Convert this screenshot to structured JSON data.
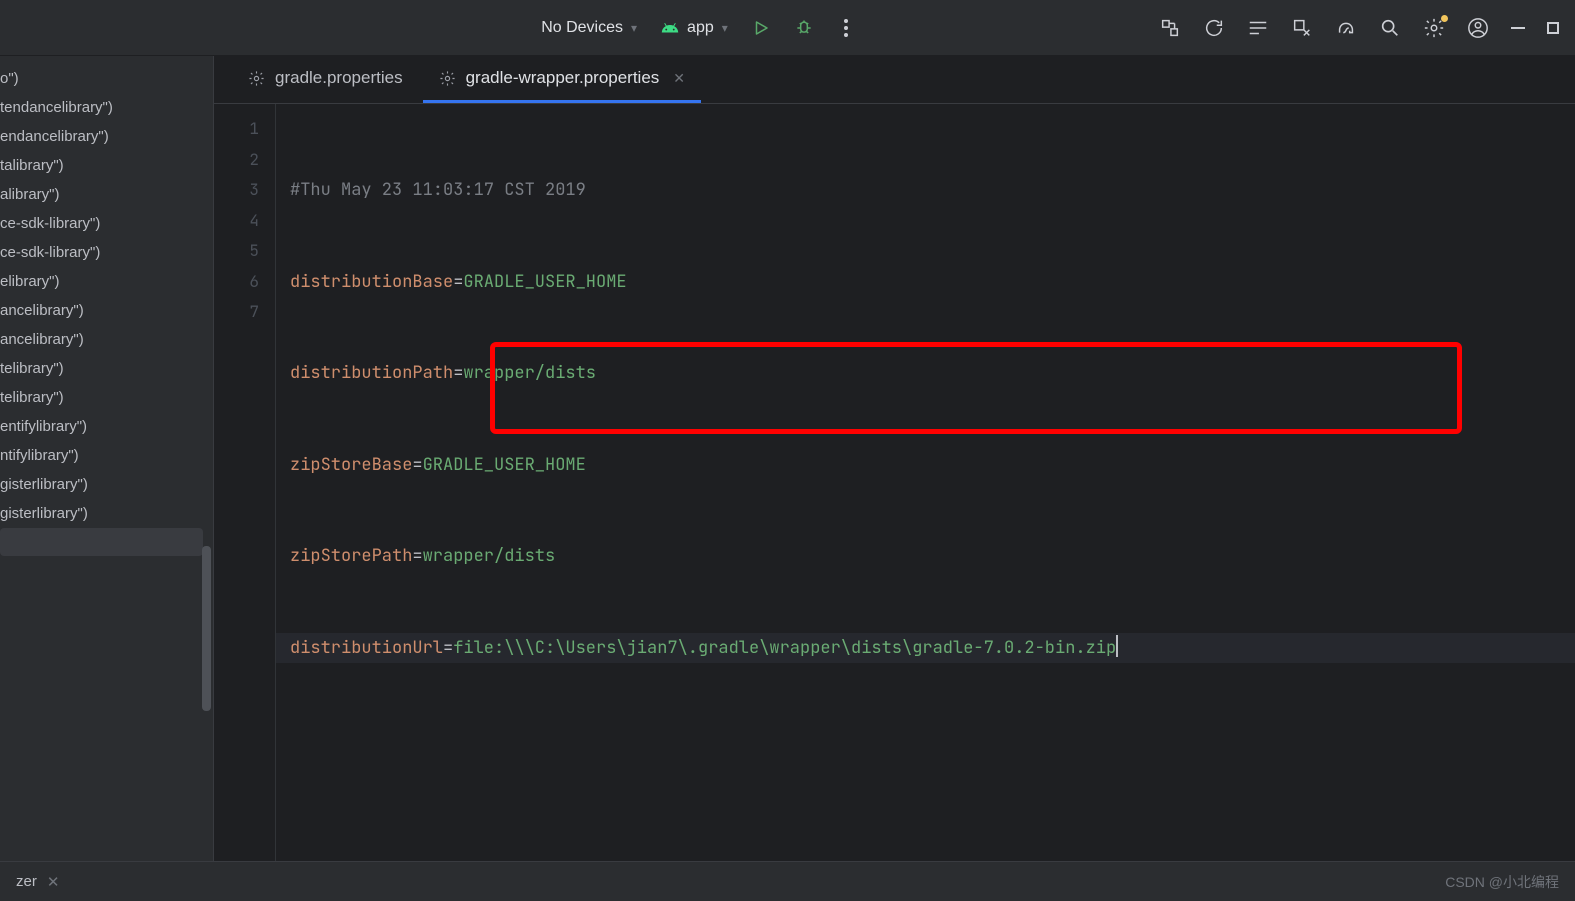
{
  "toolbar": {
    "devices_label": "No Devices",
    "config_label": "app"
  },
  "sidebar": {
    "items": [
      "o\")",
      "tendancelibrary\")",
      "endancelibrary\")",
      "talibrary\")",
      "alibrary\")",
      "ce-sdk-library\")",
      "ce-sdk-library\")",
      "elibrary\")",
      "ancelibrary\")",
      "ancelibrary\")",
      "telibrary\")",
      "telibrary\")",
      "entifylibrary\")",
      "ntifylibrary\")",
      "gisterlibrary\")",
      "gisterlibrary\")"
    ]
  },
  "tabs": [
    {
      "label": "gradle.properties",
      "active": false,
      "closable": false
    },
    {
      "label": "gradle-wrapper.properties",
      "active": true,
      "closable": true
    }
  ],
  "gutter": [
    "1",
    "2",
    "3",
    "4",
    "5",
    "6",
    "7"
  ],
  "code": {
    "l1_comment": "#Thu May 23 11:03:17 CST 2019",
    "l2_key": "distributionBase",
    "l2_val": "GRADLE_USER_HOME",
    "l3_key": "distributionPath",
    "l3_val": "wrapper/dists",
    "l4_key": "zipStoreBase",
    "l4_val": "GRADLE_USER_HOME",
    "l5_key": "zipStorePath",
    "l5_val": "wrapper/dists",
    "l6_key": "distributionUrl",
    "l6_val": "file:\\\\\\C:\\Users\\jian7\\.gradle\\wrapper\\dists\\gradle-7.0.2-bin.zip"
  },
  "statusbar": {
    "left": "zer",
    "watermark": "CSDN @小北编程"
  }
}
